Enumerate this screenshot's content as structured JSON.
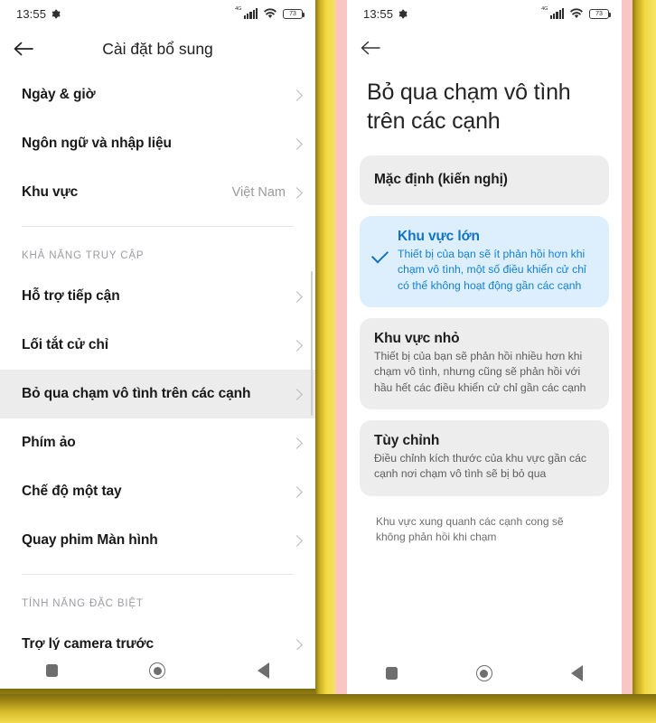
{
  "status_bar": {
    "time": "13:55",
    "gear_icon": "gear-icon",
    "network_label": "4G",
    "signal_icon": "signal-bars-icon",
    "wifi_icon": "wifi-icon",
    "battery_level": "73"
  },
  "left_screen": {
    "back_icon": "back-arrow-icon",
    "title": "Cài đặt bổ sung",
    "items_top": [
      {
        "label": "Ngày & giờ",
        "value": ""
      },
      {
        "label": "Ngôn ngữ và nhập liệu",
        "value": ""
      },
      {
        "label": "Khu vực",
        "value": "Việt Nam"
      }
    ],
    "section_accessibility": "KHẢ NĂNG TRUY CẬP",
    "items_accessibility": [
      {
        "label": "Hỗ trợ tiếp cận",
        "value": ""
      },
      {
        "label": "Lối tắt cử chỉ",
        "value": ""
      },
      {
        "label": "Bỏ qua chạm vô tình trên các cạnh",
        "value": "",
        "selected": true
      },
      {
        "label": "Phím ảo",
        "value": ""
      },
      {
        "label": "Chế độ một tay",
        "value": ""
      },
      {
        "label": "Quay phim Màn hình",
        "value": ""
      }
    ],
    "section_special": "TÍNH NĂNG ĐẶC BIỆT",
    "items_special": [
      {
        "label": "Trợ lý camera trước",
        "value": ""
      }
    ]
  },
  "right_screen": {
    "back_icon": "back-arrow-icon",
    "title": "Bỏ qua chạm vô tình trên các cạnh",
    "options": [
      {
        "title": "Mặc định (kiến nghị)",
        "desc": "",
        "selected": false
      },
      {
        "title": "Khu vực lớn",
        "desc": "Thiết bị của bạn sẽ ít phản hồi hơn khi chạm vô tình, một số điều khiển cử chỉ có thể không hoạt động gần các cạnh",
        "selected": true
      },
      {
        "title": "Khu vực nhỏ",
        "desc": "Thiết bị của bạn sẽ phản hồi nhiều hơn khi chạm vô tình, nhưng cũng sẽ phản hồi với hầu hết các điều khiển cử chỉ gần các cạnh",
        "selected": false
      },
      {
        "title": "Tùy chỉnh",
        "desc": "Điều chỉnh kích thước của khu vực gần các cạnh nơi chạm vô tình sẽ bị bỏ qua",
        "selected": false
      }
    ],
    "footnote": "Khu vực xung quanh các cạnh cong sẽ không phản hồi khi chạm",
    "check_icon": "checkmark-icon"
  },
  "nav_bar": {
    "recents_icon": "square-recents-icon",
    "home_icon": "circle-home-icon",
    "back_icon": "triangle-back-icon"
  },
  "colors": {
    "accent_blue": "#1073c6",
    "card_bg": "#ededee",
    "card_active_bg": "#ddeffd",
    "frame_yellow": "#f3d84a",
    "frame_pink": "#f9c6c4"
  }
}
